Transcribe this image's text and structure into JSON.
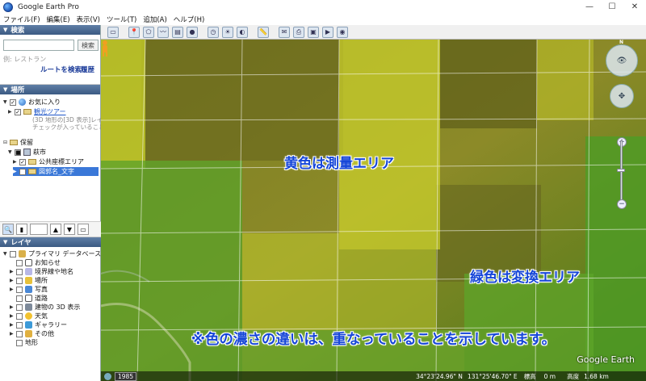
{
  "window": {
    "title": "Google Earth Pro",
    "minimize": "—",
    "maximize": "☐",
    "close": "✕"
  },
  "menu": [
    "ファイル(F)",
    "編集(E)",
    "表示(V)",
    "ツール(T)",
    "追加(A)",
    "ヘルプ(H)"
  ],
  "search": {
    "header": "検索",
    "button": "検索",
    "placeholder_hint": "例: レストラン",
    "route_link": "ルートを検索",
    "history_link": "履歴"
  },
  "places": {
    "header": "場所",
    "favorites": "お気に入り",
    "tour": "観光ツアー",
    "tour_note_1": "(3D 地形の[3D 表示]レイヤに",
    "tour_note_2": "チェックが入っていることを",
    "temporary": "保留",
    "city": "萩市",
    "public_coords": "公共座標エリア",
    "map_name": "図郭名_文字"
  },
  "layers": {
    "header": "レイヤ",
    "items": [
      "プライマリ データベース",
      "お知らせ",
      "境界線や地名",
      "場所",
      "写真",
      "道路",
      "建物の 3D 表示",
      "天気",
      "ギャラリー",
      "その他",
      "地形"
    ]
  },
  "annotations": {
    "yellow": "黄色は測量エリア",
    "green": "緑色は変換エリア",
    "note": "※色の濃さの違いは、重なっていることを示しています。"
  },
  "map": {
    "logo": "Google Earth",
    "year": "1985",
    "latitude": "34°23'24.96\" N",
    "longitude": "131°25'46.70\" E",
    "elevation_label": "標高",
    "elevation_value": "0 m",
    "altitude_label": "高度",
    "altitude_value": "1.68 km",
    "north": "N"
  },
  "colors": {
    "annotation": "#1646d8",
    "yellow_overlay": "#d8dc2a",
    "green_overlay": "#5fa82a",
    "header_bg": "#3b5a83"
  }
}
